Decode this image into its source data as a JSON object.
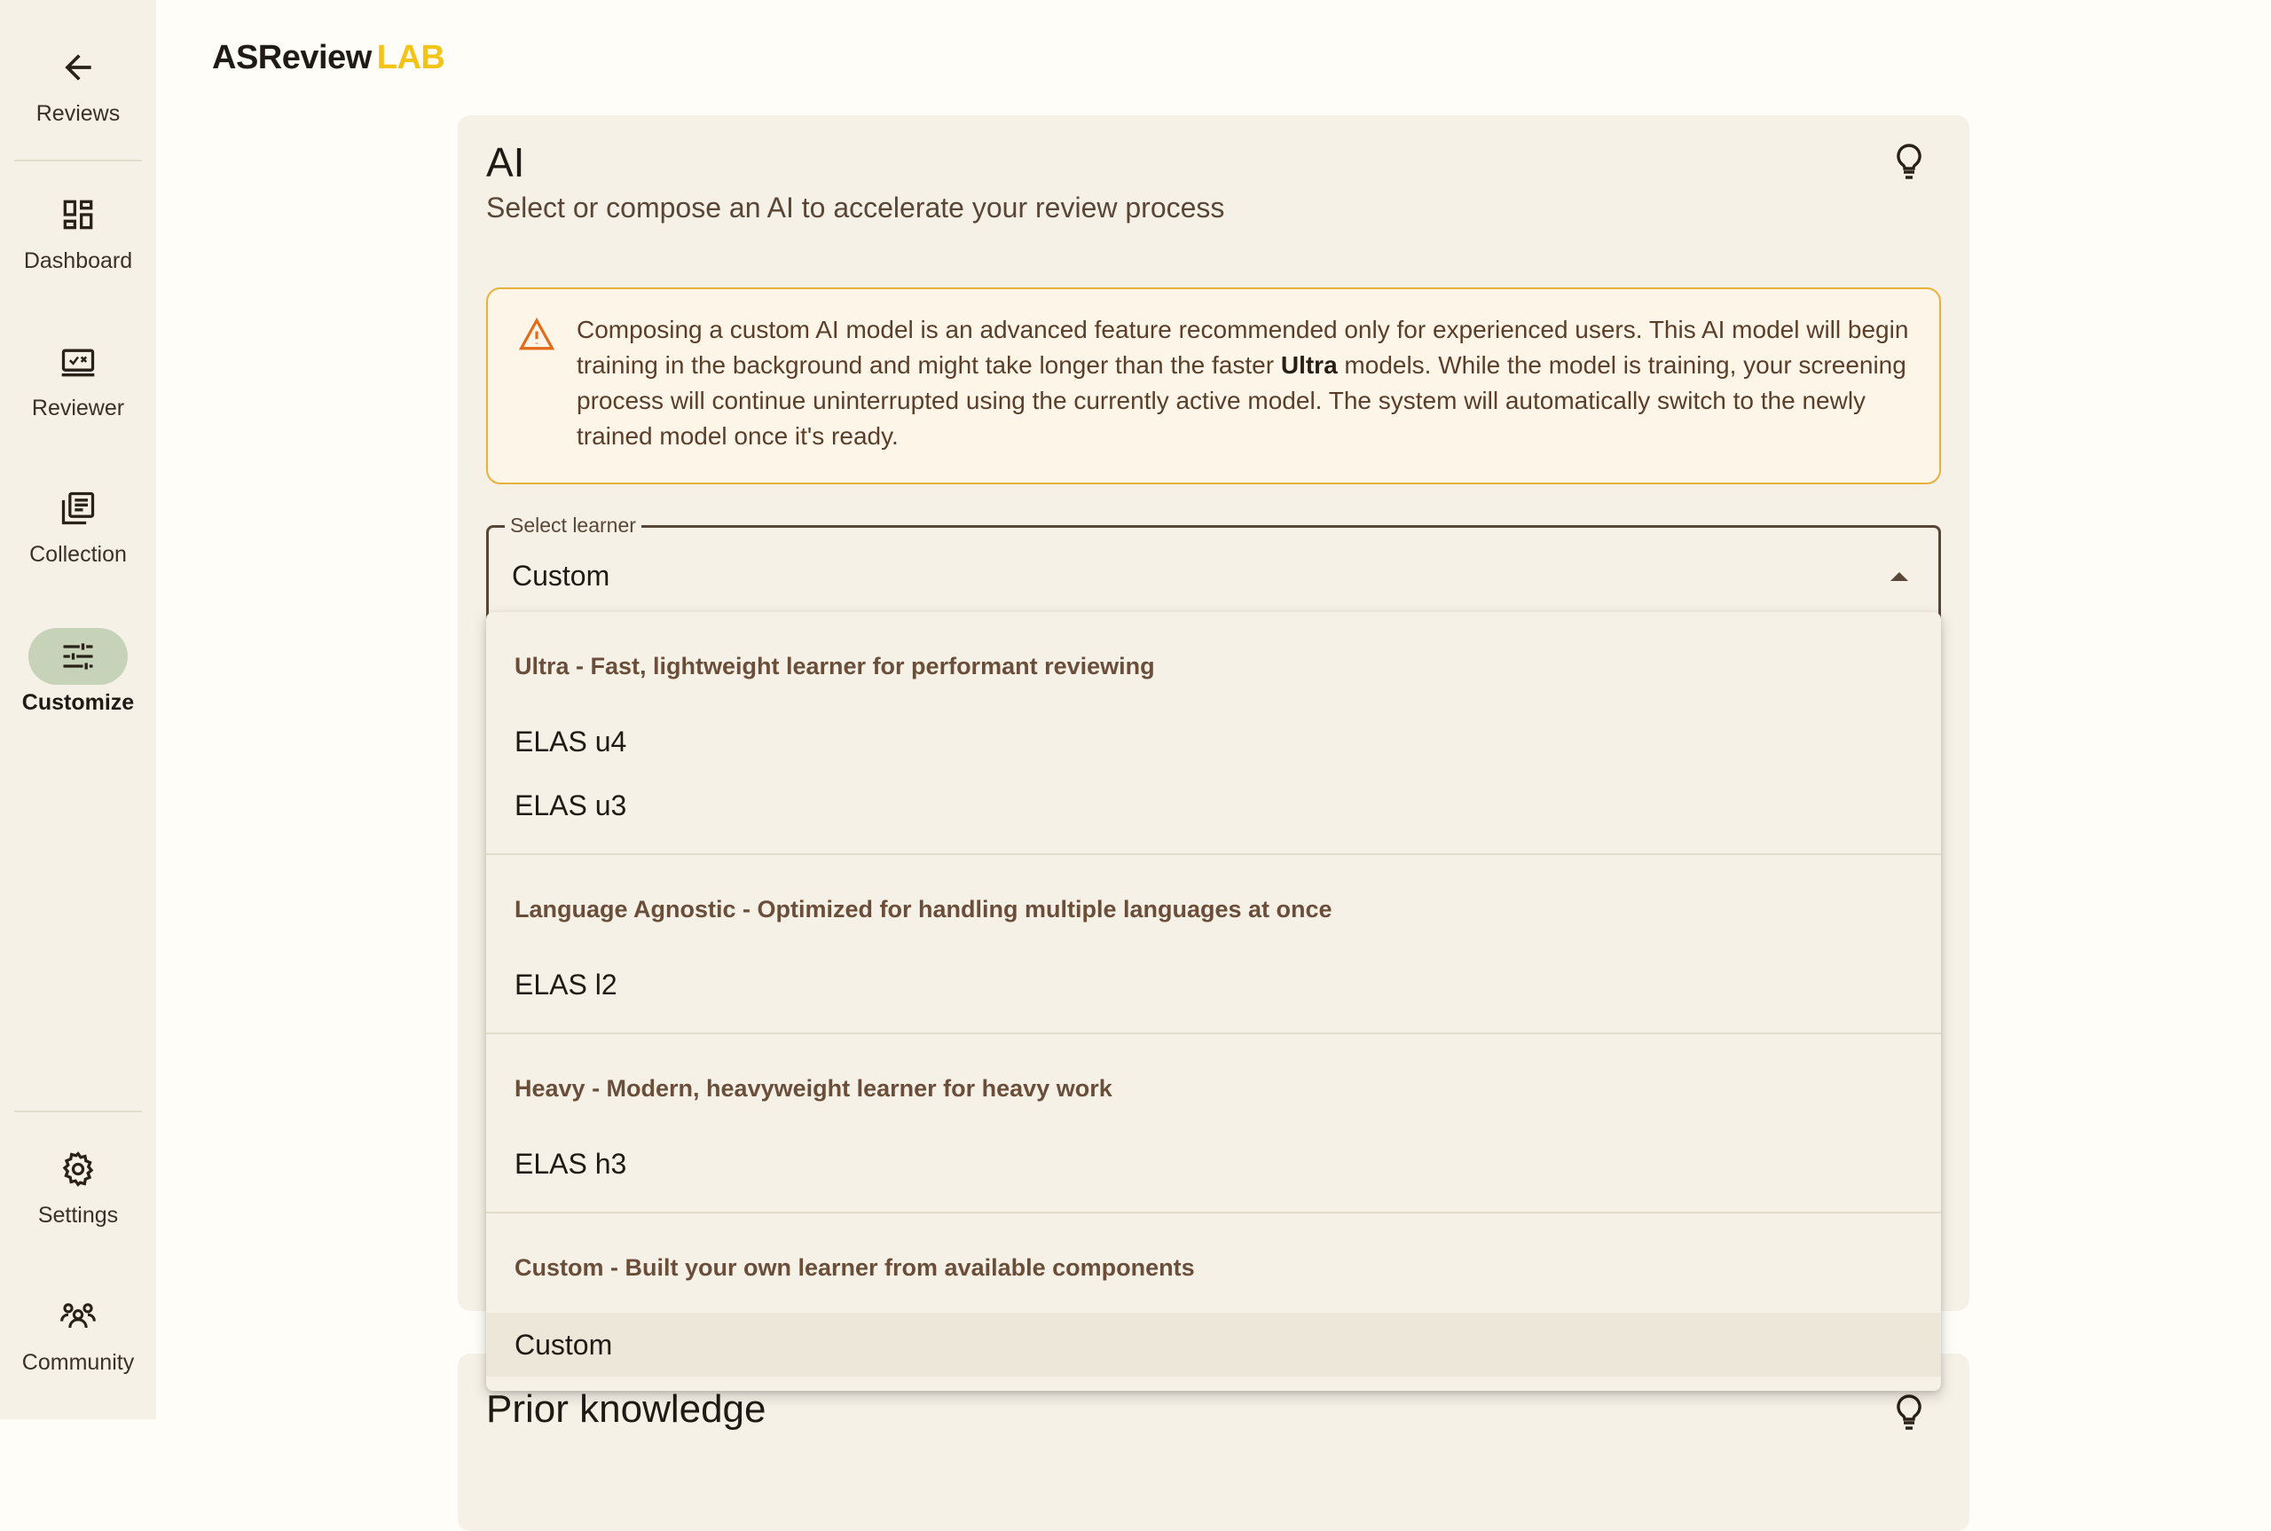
{
  "sidebar": {
    "top_items": [
      {
        "label": "Reviews",
        "icon": "arrow-back-icon"
      },
      {
        "label": "Dashboard",
        "icon": "dashboard-icon"
      },
      {
        "label": "Reviewer",
        "icon": "reviewer-icon"
      },
      {
        "label": "Collection",
        "icon": "collection-icon"
      },
      {
        "label": "Customize",
        "icon": "tune-icon",
        "active": true
      }
    ],
    "bottom_items": [
      {
        "label": "Settings",
        "icon": "gear-icon"
      },
      {
        "label": "Community",
        "icon": "community-icon"
      }
    ]
  },
  "logo": {
    "main": "ASReview",
    "accent": "LAB",
    "accent_color": "#f3c316"
  },
  "ai_card": {
    "title": "AI",
    "subtitle": "Select or compose an AI to accelerate your review process",
    "alert": {
      "text_1": "Composing a custom AI model is an advanced feature recommended only for experienced users. This AI model will begin training in the background and might take longer than the faster ",
      "bold": "Ultra",
      "text_2": " models. While the model is training, your screening process will continue uninterrupted using the currently active model. The system will automatically switch to the newly trained model once it's ready."
    },
    "select": {
      "label": "Select learner",
      "value": "Custom"
    }
  },
  "menu": {
    "groups": [
      {
        "header": "Ultra - Fast, lightweight learner for performant reviewing",
        "options": [
          "ELAS u4",
          "ELAS u3"
        ]
      },
      {
        "header": "Language Agnostic - Optimized for handling multiple languages at once",
        "options": [
          "ELAS l2"
        ]
      },
      {
        "header": "Heavy - Modern, heavyweight learner for heavy work",
        "options": [
          "ELAS h3"
        ]
      },
      {
        "header": "Custom - Built your own learner from available components",
        "options": [
          "Custom"
        ]
      }
    ],
    "selected": "Custom"
  },
  "next_card": {
    "title": "Prior knowledge"
  }
}
